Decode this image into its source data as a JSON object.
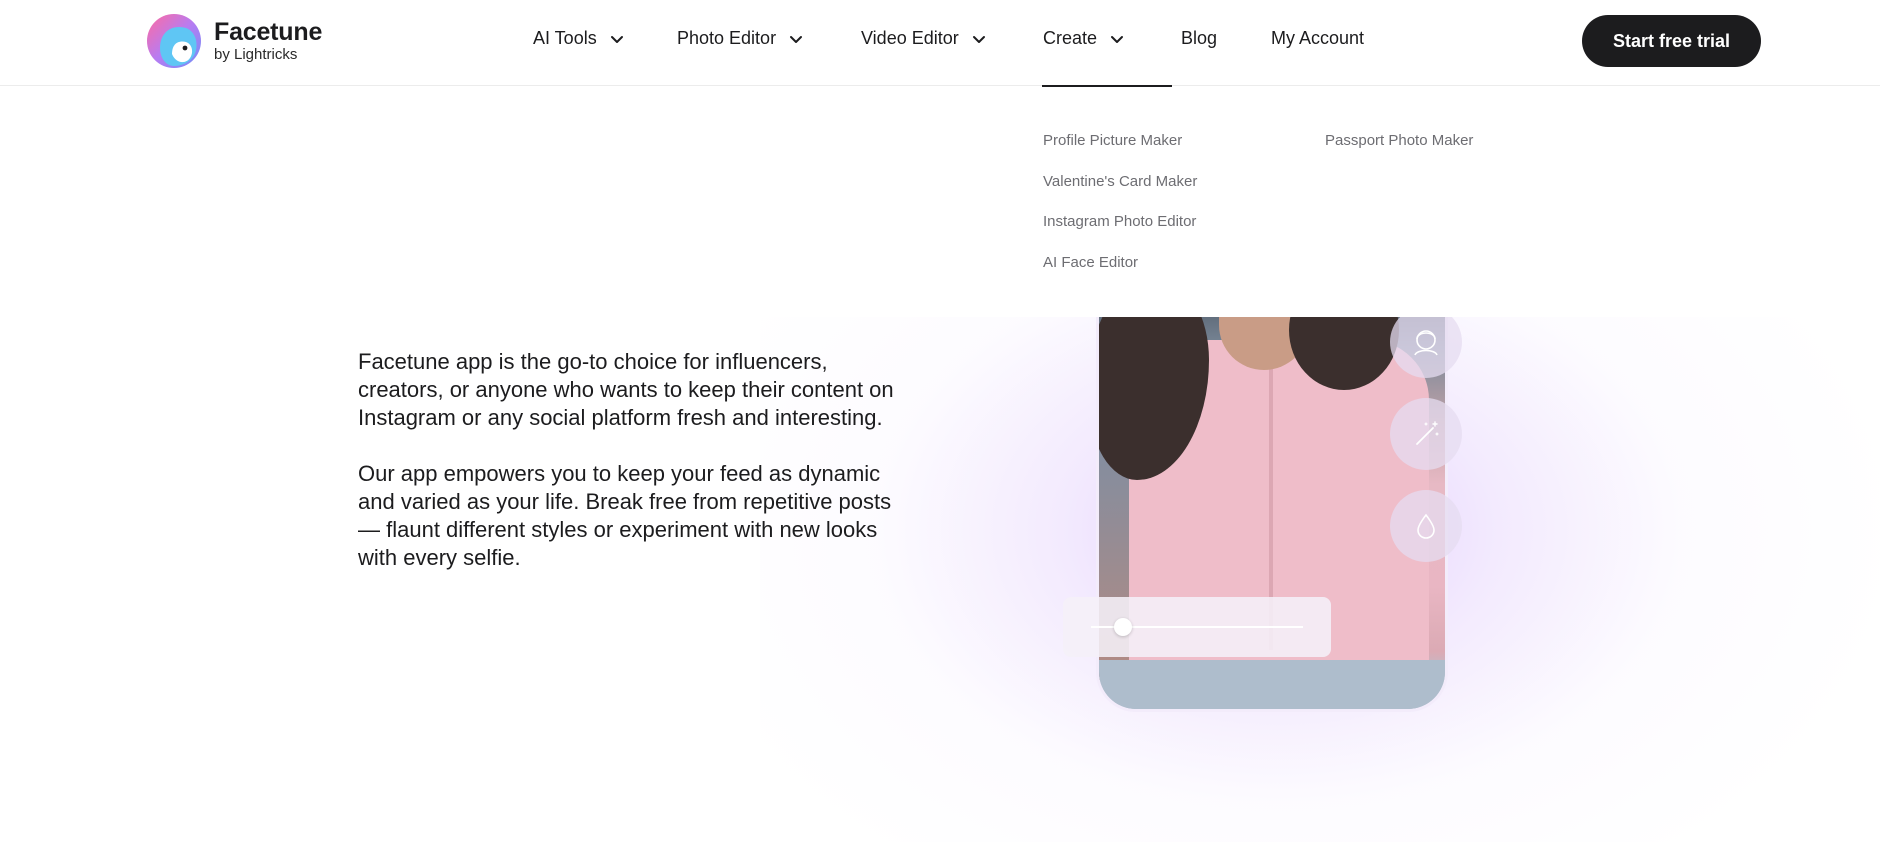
{
  "brand": {
    "name": "Facetune",
    "byline": "by Lightricks"
  },
  "nav": {
    "items": [
      {
        "label": "AI Tools",
        "has_dropdown": true
      },
      {
        "label": "Photo Editor",
        "has_dropdown": true
      },
      {
        "label": "Video Editor",
        "has_dropdown": true
      },
      {
        "label": "Create",
        "has_dropdown": true,
        "active": true
      },
      {
        "label": "Blog",
        "has_dropdown": false
      },
      {
        "label": "My Account",
        "has_dropdown": false
      }
    ],
    "cta_label": "Start free trial"
  },
  "create_menu": {
    "col1": [
      "Profile Picture Maker",
      "Valentine's Card Maker",
      "Instagram Photo Editor",
      "AI Face Editor"
    ],
    "col2": [
      "Passport Photo Maker"
    ]
  },
  "hero": {
    "paragraph1": "Facetune app is the go-to choice for influencers, creators, or anyone who wants to keep their content on Instagram or any social platform fresh and interesting.",
    "paragraph2": "Our app empowers you to keep your feed as dynamic and varied as your life. Break free from repetitive posts — flaunt different styles or experiment with new looks with every selfie.",
    "tools": [
      "face-icon",
      "magic-wand-icon",
      "droplet-icon"
    ],
    "slider_value": 0.15
  },
  "colors": {
    "primary_dark": "#1c1c1e",
    "menu_link": "#6d6d72",
    "glow_purple": "#c8a0fa"
  }
}
